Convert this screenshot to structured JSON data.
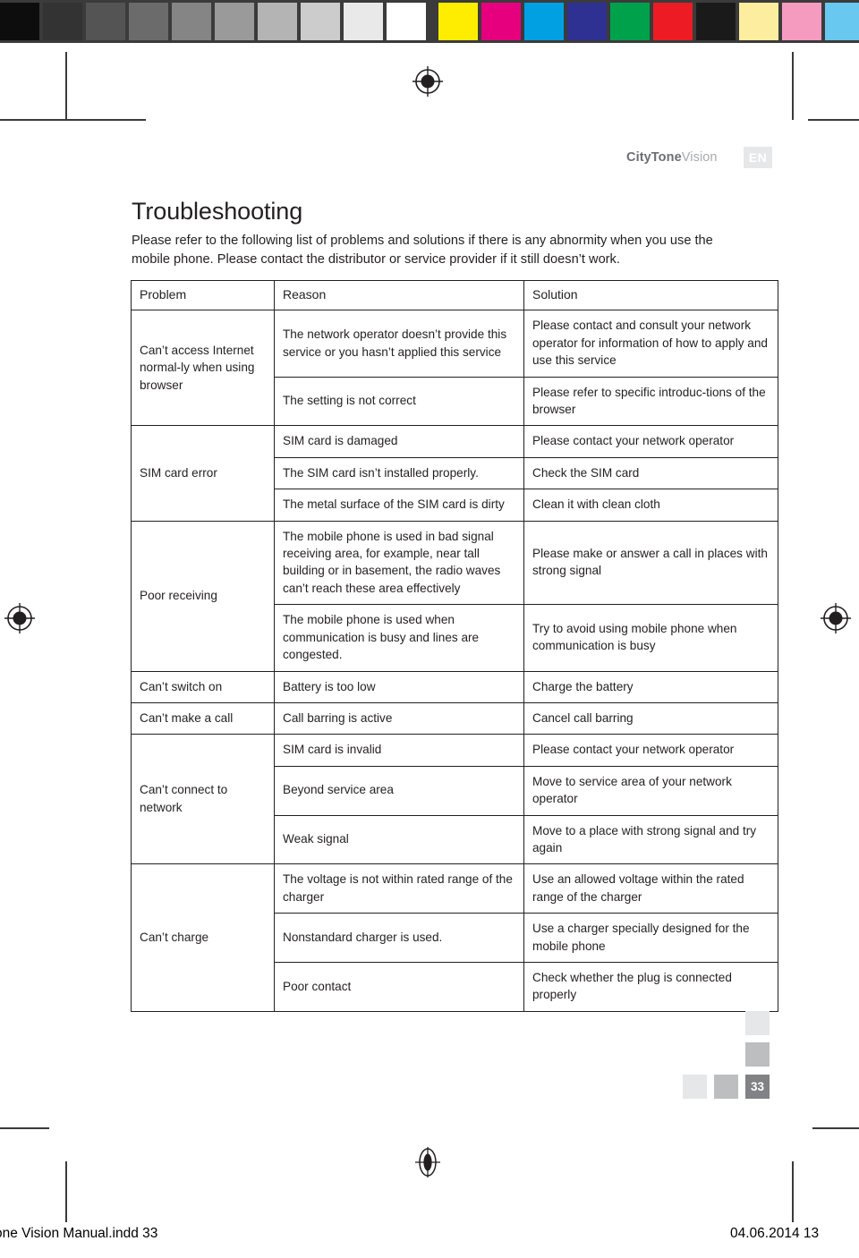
{
  "printbar": {
    "grayscale": [
      "#0d0d0d",
      "#333333",
      "#545454",
      "#6b6b6b",
      "#858585",
      "#9a9a9a",
      "#b4b4b4",
      "#cccccc",
      "#e9e9e9",
      "#ffffff"
    ],
    "colors": [
      "#ffed00",
      "#e6007e",
      "#00a0e3",
      "#2e3192",
      "#00a14b",
      "#ed1c24",
      "#1a1a1a",
      "#fcee9e",
      "#f59bc0",
      "#68c8f0"
    ]
  },
  "header": {
    "brand_bold": "CityTone",
    "brand_light": "Vision",
    "language_badge": "EN"
  },
  "title": "Troubleshooting",
  "intro": "Please refer to the following list of problems and solutions if there is any abnormity when you use the mobile phone. Please contact the distributor or service provider if it still doesn’t work.",
  "table": {
    "headers": [
      "Problem",
      "Reason",
      "Solution"
    ],
    "rows": [
      {
        "problem": "Can’t access Internet normal-ly when using browser",
        "problem_rowspan": 2,
        "entries": [
          {
            "reason": "The network operator doesn’t provide this service or you hasn’t applied this service",
            "solution": "Please contact and consult your network operator for information of how to apply and use this service"
          },
          {
            "reason": "The setting is not correct",
            "solution": "Please refer to specific introduc-tions of the browser"
          }
        ]
      },
      {
        "problem": "SIM card error",
        "problem_rowspan": 3,
        "entries": [
          {
            "reason": "SIM card is damaged",
            "solution": "Please contact your network operator"
          },
          {
            "reason": "The SIM card isn’t installed properly.",
            "solution": "Check the SIM card"
          },
          {
            "reason": "The metal surface of the SIM card is dirty",
            "solution": "Clean it with clean cloth"
          }
        ]
      },
      {
        "problem": "Poor receiving",
        "problem_rowspan": 2,
        "entries": [
          {
            "reason": "The mobile phone is used in bad signal receiving area, for example, near tall building or in basement, the radio waves can’t reach these area effectively",
            "solution": "Please make or answer a call in places with strong signal"
          },
          {
            "reason": "The mobile phone is used when communication is busy and lines are congested.",
            "solution": "Try to avoid using mobile phone when communication is busy"
          }
        ]
      },
      {
        "problem": "Can’t switch on",
        "problem_rowspan": 1,
        "entries": [
          {
            "reason": "Battery is too low",
            "solution": "Charge the battery"
          }
        ]
      },
      {
        "problem": "Can’t make a call",
        "problem_rowspan": 1,
        "entries": [
          {
            "reason": "Call barring is active",
            "solution": "Cancel call barring"
          }
        ]
      },
      {
        "problem": "Can’t connect to network",
        "problem_rowspan": 3,
        "entries": [
          {
            "reason": "SIM card is invalid",
            "solution": "Please contact your network operator"
          },
          {
            "reason": "Beyond service area",
            "solution": "Move to service area of your network operator"
          },
          {
            "reason": "Weak signal",
            "solution": "Move to a place with strong signal and try again"
          }
        ]
      },
      {
        "problem": "Can’t charge",
        "problem_rowspan": 3,
        "entries": [
          {
            "reason": "The voltage is not within rated range of the charger",
            "solution": "Use an allowed voltage within the rated range of the charger"
          },
          {
            "reason": "Nonstandard charger is used.",
            "solution": "Use a charger specially designed for the mobile phone"
          },
          {
            "reason": "Poor contact",
            "solution": "Check whether the plug is connected properly"
          }
        ]
      }
    ]
  },
  "page_marker": {
    "number": "33",
    "block_colors": [
      "#e6e7e8",
      "#bcbec0",
      "#e6e7e8",
      "#bcbec0"
    ],
    "number_bg": "#808285"
  },
  "footer": {
    "left": "one Vision Manual.indd   33",
    "right": "04.06.2014   13"
  }
}
